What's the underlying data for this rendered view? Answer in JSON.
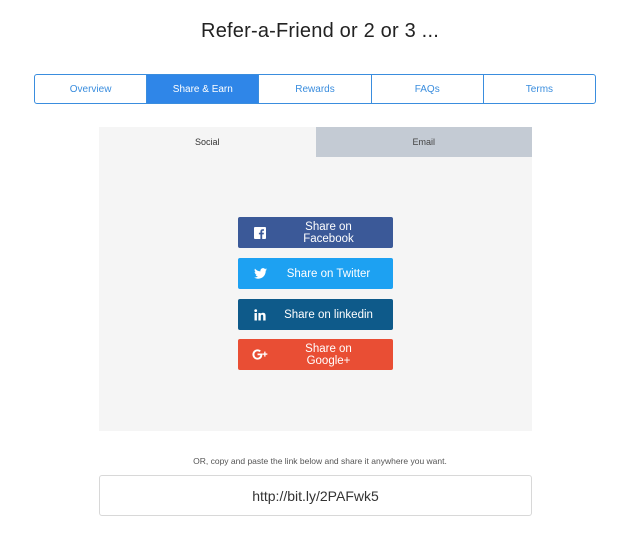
{
  "page": {
    "title": "Refer-a-Friend or 2 or 3 ..."
  },
  "tabs": [
    {
      "label": "Overview",
      "active": false
    },
    {
      "label": "Share & Earn",
      "active": true
    },
    {
      "label": "Rewards",
      "active": false
    },
    {
      "label": "FAQs",
      "active": false
    },
    {
      "label": "Terms",
      "active": false
    }
  ],
  "subtabs": [
    {
      "label": "Social",
      "active": true
    },
    {
      "label": "Email",
      "active": false
    }
  ],
  "share_buttons": [
    {
      "label": "Share on Facebook",
      "icon": "facebook-icon",
      "color": "#3b5998"
    },
    {
      "label": "Share on Twitter",
      "icon": "twitter-icon",
      "color": "#1da1f2"
    },
    {
      "label": "Share on linkedin",
      "icon": "linkedin-icon",
      "color": "#0e5a8a"
    },
    {
      "label": "Share on Google+",
      "icon": "google-plus-icon",
      "color": "#e94e34"
    }
  ],
  "helper_text": "OR, copy and paste the link below and share it anywhere you want.",
  "link": {
    "value": "http://bit.ly/2PAFwk5"
  },
  "colors": {
    "accent": "#2f86e8",
    "panel_bg": "#f5f5f5",
    "inactive_subtab": "#c4cbd4"
  }
}
